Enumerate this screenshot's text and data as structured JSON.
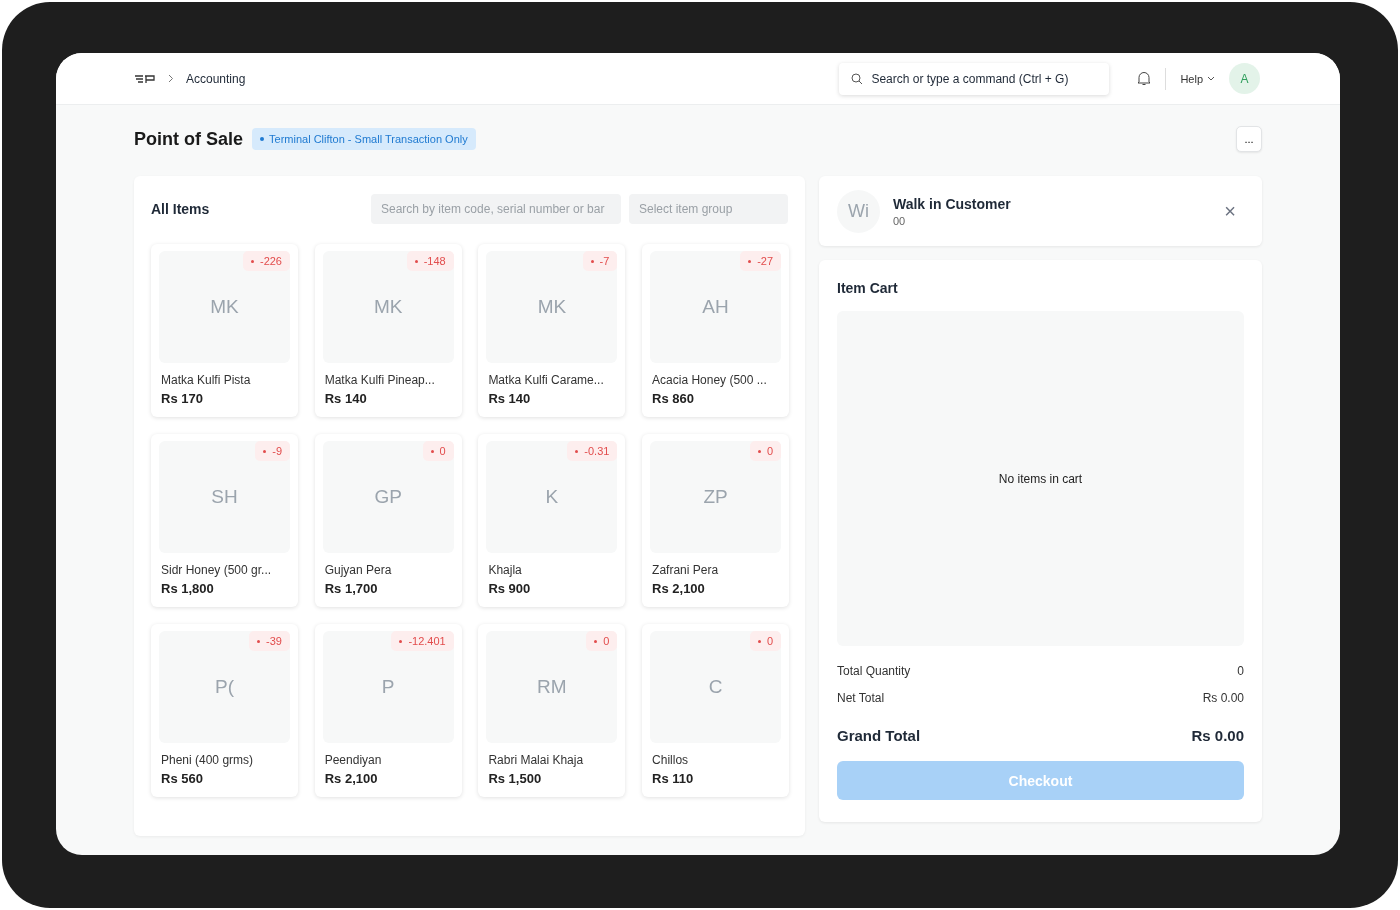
{
  "navbar": {
    "breadcrumb": "Accounting",
    "search": {
      "value": "Search or type a command (Ctrl + G)"
    },
    "help": "Help",
    "avatar": "A"
  },
  "page": {
    "title": "Point of Sale",
    "status": "Terminal Clifton - Small Transaction Only",
    "menu": "..."
  },
  "items_panel": {
    "title": "All Items",
    "search": {
      "placeholder": "Search by item code, serial number or bar"
    },
    "group": {
      "placeholder": "Select item group"
    },
    "items": [
      {
        "initials": "MK",
        "stock": "-226",
        "name": "Matka Kulfi Pista",
        "price": "Rs 170"
      },
      {
        "initials": "MK",
        "stock": "-148",
        "name": "Matka Kulfi Pineap...",
        "price": "Rs 140"
      },
      {
        "initials": "MK",
        "stock": "-7",
        "name": "Matka Kulfi Carame...",
        "price": "Rs 140"
      },
      {
        "initials": "AH",
        "stock": "-27",
        "name": "Acacia Honey (500 ...",
        "price": "Rs 860"
      },
      {
        "initials": "SH",
        "stock": "-9",
        "name": "Sidr Honey (500 gr...",
        "price": "Rs 1,800"
      },
      {
        "initials": "GP",
        "stock": "0",
        "name": "Gujyan Pera",
        "price": "Rs 1,700"
      },
      {
        "initials": "K",
        "stock": "-0.31",
        "name": "Khajla",
        "price": "Rs 900"
      },
      {
        "initials": "ZP",
        "stock": "0",
        "name": "Zafrani Pera",
        "price": "Rs 2,100"
      },
      {
        "initials": "P(",
        "stock": "-39",
        "name": "Pheni (400 grms)",
        "price": "Rs 560"
      },
      {
        "initials": "P",
        "stock": "-12.401",
        "name": "Peendiyan",
        "price": "Rs 2,100"
      },
      {
        "initials": "RM",
        "stock": "0",
        "name": "Rabri Malai Khaja",
        "price": "Rs 1,500"
      },
      {
        "initials": "C",
        "stock": "0",
        "name": "Chillos",
        "price": "Rs 110"
      }
    ]
  },
  "customer": {
    "initials": "Wi",
    "name": "Walk in Customer",
    "code": "00",
    "close": "×"
  },
  "cart": {
    "title": "Item Cart",
    "empty": "No items in cart",
    "totals": [
      {
        "label": "Total Quantity",
        "value": "0",
        "kind": "normal"
      },
      {
        "label": "Net Total",
        "value": "Rs 0.00",
        "kind": "normal"
      },
      {
        "label": "Grand Total",
        "value": "Rs 0.00",
        "kind": "grand"
      }
    ],
    "checkout": {
      "label": "Checkout",
      "disabled": true
    }
  }
}
